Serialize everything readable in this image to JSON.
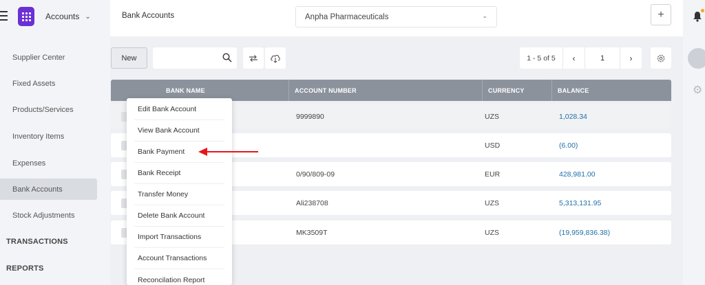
{
  "topbar": {
    "module": "Accounts",
    "page_title": "Bank Accounts",
    "company": "Anpha Pharmaceuticals",
    "add_icon": "plus-icon"
  },
  "sidebar": {
    "items": [
      {
        "label": "Supplier Center"
      },
      {
        "label": "Fixed Assets"
      },
      {
        "label": "Products/Services"
      },
      {
        "label": "Inventory Items"
      },
      {
        "label": "Expenses"
      },
      {
        "label": "Bank Accounts",
        "active": true
      },
      {
        "label": "Stock Adjustments"
      }
    ],
    "sections": [
      "TRANSACTIONS",
      "REPORTS"
    ]
  },
  "toolbar": {
    "new_label": "New",
    "search_value": "",
    "search_placeholder": "",
    "pager_count": "1 - 5 of 5",
    "current_page": "1"
  },
  "table": {
    "columns": [
      "BANK NAME",
      "ACCOUNT NUMBER",
      "CURRENCY",
      "BALANCE"
    ],
    "rows": [
      {
        "account": "9999890",
        "currency": "UZS",
        "balance": "1,028.34"
      },
      {
        "account": "",
        "currency": "USD",
        "balance": "(6.00)"
      },
      {
        "account": "0/90/809-09",
        "currency": "EUR",
        "balance": "428,981.00"
      },
      {
        "account": "Ali238708",
        "currency": "UZS",
        "balance": "5,313,131.95"
      },
      {
        "account": "MK3509T",
        "currency": "UZS",
        "balance": "(19,959,836.38)"
      }
    ]
  },
  "context_menu": {
    "items": [
      "Edit Bank Account",
      "View Bank Account",
      "Bank Payment",
      "Bank Receipt",
      "Transfer Money",
      "Delete Bank Account",
      "Import Transactions",
      "Account Transactions",
      "Reconcilation Report"
    ]
  },
  "colors": {
    "accent": "#6b2fd6",
    "header": "#8c929c",
    "balance_text": "#1e6fa8",
    "arrow": "#e8141b"
  }
}
